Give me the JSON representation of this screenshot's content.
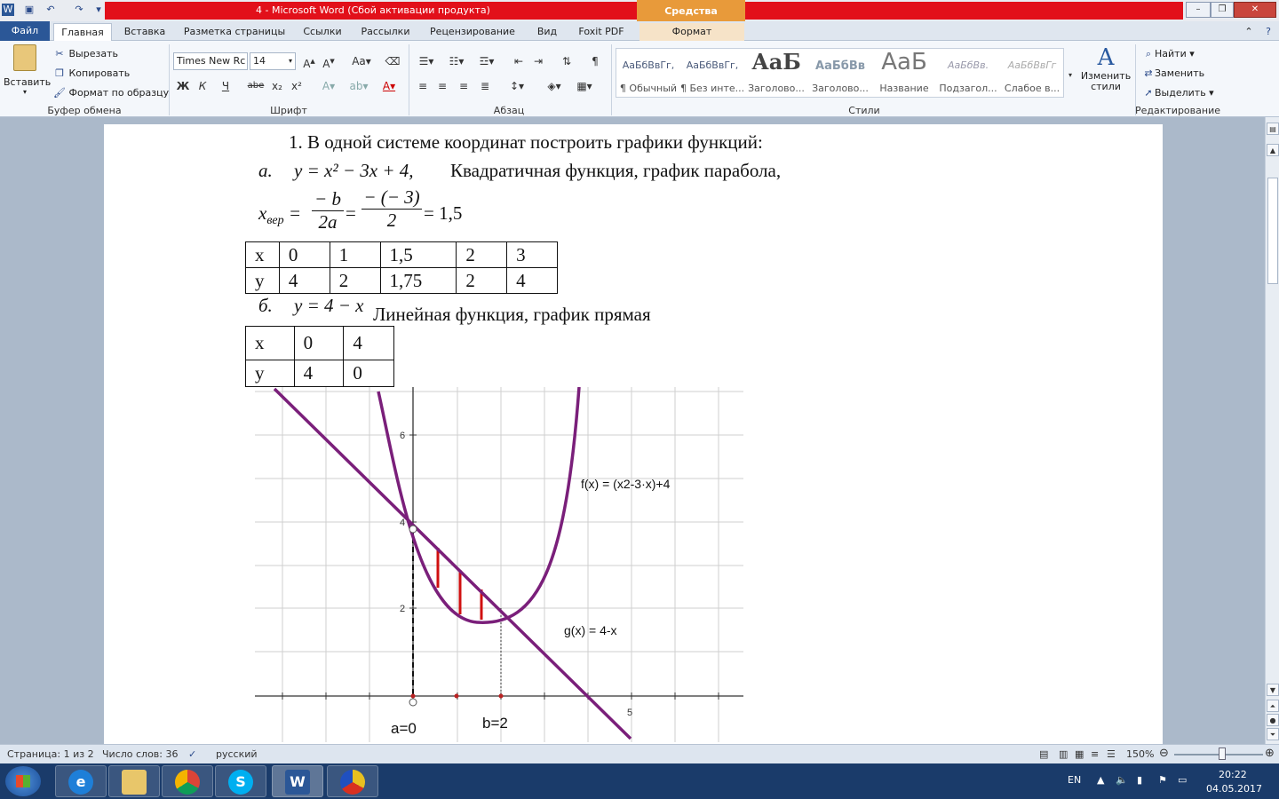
{
  "window": {
    "title": "4 - Microsoft Word (Сбой активации продукта)",
    "context_tab": "Средства рисования",
    "accent": "#e2101a"
  },
  "tabs": [
    "Файл",
    "Главная",
    "Вставка",
    "Разметка страницы",
    "Ссылки",
    "Рассылки",
    "Рецензирование",
    "Вид",
    "Foxit PDF",
    "Формат"
  ],
  "ribbon": {
    "clipboard": {
      "paste": "Вставить",
      "cut": "Вырезать",
      "copy": "Копировать",
      "format_painter": "Формат по образцу",
      "label": "Буфер обмена"
    },
    "font": {
      "family": "Times New Rc",
      "size": "14",
      "label": "Шрифт",
      "bold": "Ж",
      "italic": "К",
      "underline": "Ч",
      "strike": "abe"
    },
    "paragraph": {
      "label": "Абзац"
    },
    "styles": {
      "label": "Стили",
      "items": [
        {
          "preview": "АаБбВвГг,",
          "name": "¶ Обычный"
        },
        {
          "preview": "АаБбВвГг,",
          "name": "¶ Без инте..."
        },
        {
          "preview": "АаБ",
          "name": "Заголово..."
        },
        {
          "preview": "АаБбВв",
          "name": "Заголово..."
        },
        {
          "preview": "АаБ",
          "name": "Название"
        },
        {
          "preview": "АаБбВв.",
          "name": "Подзагол..."
        },
        {
          "preview": "АаБбВвГг",
          "name": "Слабое в..."
        }
      ],
      "change": "Изменить стили"
    },
    "editing": {
      "label": "Редактирование",
      "find": "Найти",
      "replace": "Заменить",
      "select": "Выделить"
    }
  },
  "document": {
    "line1": "1.   В одной системе координат построить графики функций:",
    "line_a_marker": "а.",
    "line_a_formula": "y = x² − 3x + 4,",
    "line_a_text": "Квадратичная функция, график парабола,",
    "vertex_lhs": "x",
    "vertex_sub": "вер",
    "vertex_num1": "− b",
    "vertex_den1": "2a",
    "vertex_num2": "− (− 3)",
    "vertex_den2": "2",
    "vertex_result": "= 1,5",
    "table1": [
      [
        "x",
        "0",
        "1",
        "1,5",
        "2",
        "3"
      ],
      [
        "y",
        "4",
        "2",
        "1,75",
        "2",
        "4"
      ]
    ],
    "line_b_marker": "б.",
    "line_b_formula": "y = 4 − x",
    "line_b_text": "Линейная функция, график прямая",
    "table2": [
      [
        "x",
        "0",
        "4"
      ],
      [
        "y",
        "4",
        "0"
      ]
    ]
  },
  "graph": {
    "f_label": "f(x) = (x2-3·x)+4",
    "g_label": "g(x) = 4-x",
    "a_label": "a=0",
    "b_label": "b=2",
    "tick_6": "6",
    "tick_4": "4",
    "tick_2": "2",
    "tick_5": "5",
    "curve_color": "#7a1f7a",
    "hatch_color": "#d01010"
  },
  "status": {
    "page": "Страница: 1 из 2",
    "words": "Число слов: 36",
    "lang": "русский",
    "zoom": "150%"
  },
  "taskbar": {
    "lang": "EN",
    "time": "20:22",
    "date": "04.05.2017"
  }
}
